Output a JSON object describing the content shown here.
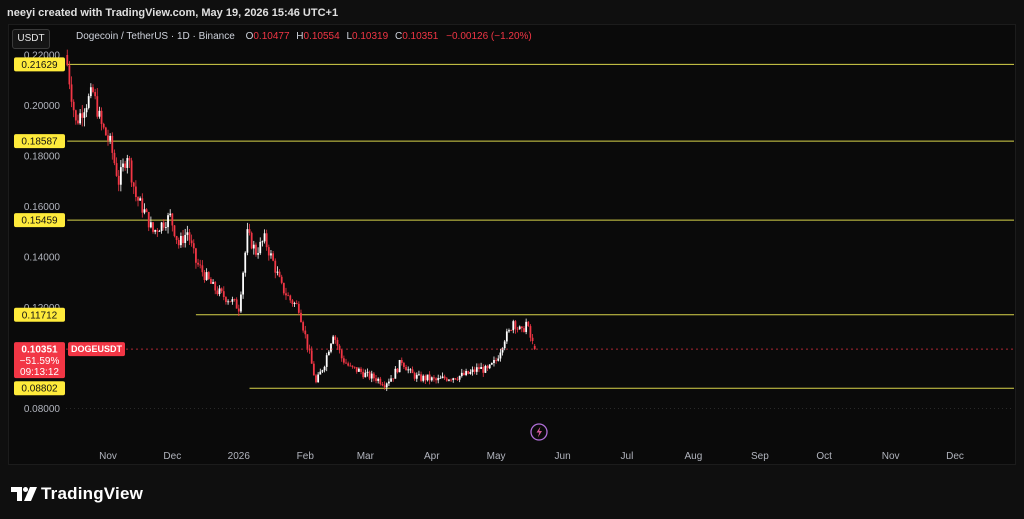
{
  "header": {
    "credit": "neeyi created with TradingView.com, May 19, 2026 15:46 UTC+1"
  },
  "toolbar": {
    "currency_label": "USDT"
  },
  "legend": {
    "symbol": "Dogecoin / TetherUS · 1D · Binance",
    "open_label": "O",
    "open": "0.10477",
    "high_label": "H",
    "high": "0.10554",
    "low_label": "L",
    "low": "0.10319",
    "close_label": "C",
    "close": "0.10351",
    "change": "−0.00126 (−1.20%)"
  },
  "price_tag": {
    "value": "0.10351",
    "change_pct": "−51.59%",
    "countdown": "09:13:12",
    "symbol": "DOGEUSDT"
  },
  "brand": {
    "name": "TradingView"
  },
  "colors": {
    "up": "#ffffff",
    "down": "#f23645",
    "level_line": "#d8d34a",
    "level_tag_bg": "#ffeb3b",
    "price_tag_bg": "#f23645",
    "symbol_badge_bg": "#f23645"
  },
  "chart_data": {
    "type": "candlestick",
    "symbol": "Dogecoin / TetherUS",
    "interval": "1D",
    "exchange": "Binance",
    "y_ticks": [
      "0.22000",
      "0.20000",
      "0.18000",
      "0.16000",
      "0.14000",
      "0.12000",
      "0.08000"
    ],
    "x_ticks": [
      "Nov",
      "Dec",
      "2026",
      "Feb",
      "Mar",
      "Apr",
      "May",
      "Jun",
      "Jul",
      "Aug",
      "Sep",
      "Oct",
      "Nov",
      "Dec"
    ],
    "horizontal_levels": [
      {
        "label": "0.21629",
        "value": 0.21629,
        "from": "2025-10-13"
      },
      {
        "label": "0.18587",
        "value": 0.18587,
        "from": "2025-10-13"
      },
      {
        "label": "0.15459",
        "value": 0.15459,
        "from": "2025-10-13"
      },
      {
        "label": "0.11712",
        "value": 0.11712,
        "from": "2025-12-12"
      },
      {
        "label": "0.08802",
        "value": 0.08802,
        "from": "2026-01-06"
      }
    ],
    "last_price": 0.10351,
    "closes_by_date": [
      [
        "2025-10-13",
        0.216
      ],
      [
        "2025-10-17",
        0.193
      ],
      [
        "2025-10-21",
        0.2
      ],
      [
        "2025-10-25",
        0.205
      ],
      [
        "2025-10-29",
        0.192
      ],
      [
        "2025-11-02",
        0.185
      ],
      [
        "2025-11-06",
        0.17
      ],
      [
        "2025-11-10",
        0.181
      ],
      [
        "2025-11-14",
        0.164
      ],
      [
        "2025-11-18",
        0.158
      ],
      [
        "2025-11-22",
        0.15
      ],
      [
        "2025-11-26",
        0.153
      ],
      [
        "2025-11-30",
        0.156
      ],
      [
        "2025-12-04",
        0.145
      ],
      [
        "2025-12-08",
        0.15
      ],
      [
        "2025-12-12",
        0.138
      ],
      [
        "2025-12-16",
        0.133
      ],
      [
        "2025-12-20",
        0.128
      ],
      [
        "2025-12-24",
        0.125
      ],
      [
        "2025-12-28",
        0.123
      ],
      [
        "2026-01-01",
        0.12
      ],
      [
        "2026-01-05",
        0.149
      ],
      [
        "2026-01-09",
        0.142
      ],
      [
        "2026-01-13",
        0.147
      ],
      [
        "2026-01-17",
        0.138
      ],
      [
        "2026-01-21",
        0.128
      ],
      [
        "2026-01-25",
        0.123
      ],
      [
        "2026-01-29",
        0.12
      ],
      [
        "2026-02-02",
        0.105
      ],
      [
        "2026-02-06",
        0.09
      ],
      [
        "2026-02-10",
        0.098
      ],
      [
        "2026-02-14",
        0.11
      ],
      [
        "2026-02-18",
        0.1
      ],
      [
        "2026-02-22",
        0.096
      ],
      [
        "2026-02-26",
        0.095
      ],
      [
        "2026-03-02",
        0.093
      ],
      [
        "2026-03-06",
        0.092
      ],
      [
        "2026-03-10",
        0.09
      ],
      [
        "2026-03-14",
        0.093
      ],
      [
        "2026-03-18",
        0.099
      ],
      [
        "2026-03-22",
        0.094
      ],
      [
        "2026-03-26",
        0.092
      ],
      [
        "2026-03-30",
        0.092
      ],
      [
        "2026-04-03",
        0.091
      ],
      [
        "2026-04-07",
        0.092
      ],
      [
        "2026-04-11",
        0.0925
      ],
      [
        "2026-04-15",
        0.093
      ],
      [
        "2026-04-19",
        0.094
      ],
      [
        "2026-04-23",
        0.096
      ],
      [
        "2026-04-27",
        0.095
      ],
      [
        "2026-05-01",
        0.099
      ],
      [
        "2026-05-05",
        0.108
      ],
      [
        "2026-05-07",
        0.11
      ],
      [
        "2026-05-09",
        0.115
      ],
      [
        "2026-05-11",
        0.112
      ],
      [
        "2026-05-13",
        0.11
      ],
      [
        "2026-05-15",
        0.114
      ],
      [
        "2026-05-17",
        0.108
      ],
      [
        "2026-05-19",
        0.1035
      ]
    ]
  }
}
